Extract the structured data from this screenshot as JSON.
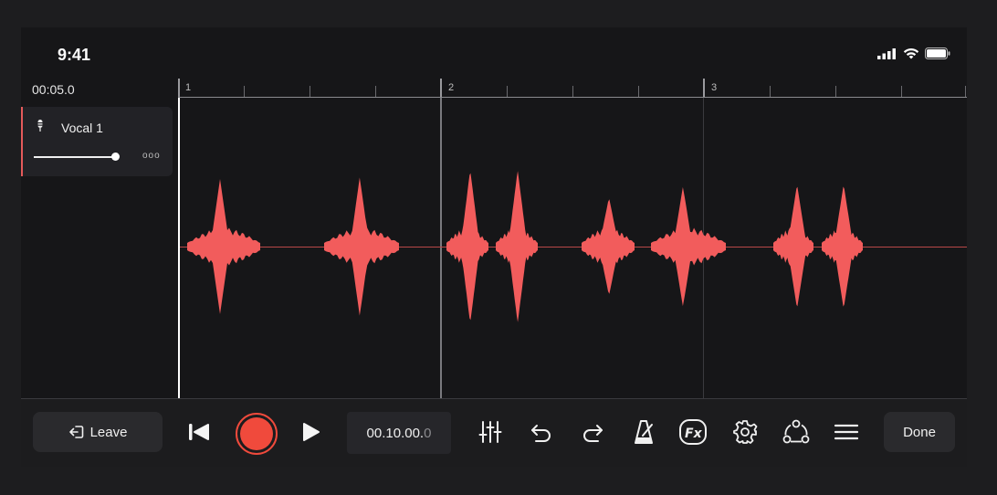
{
  "status_bar": {
    "time": "9:41"
  },
  "position_readout": "00:05.0",
  "ruler": {
    "bars": [
      "1",
      "2",
      "3"
    ]
  },
  "track": {
    "name": "Vocal 1",
    "volume": 0.82,
    "more_label": "ooo"
  },
  "toolbar": {
    "leave_label": "Leave",
    "time_main": "00.10.00.",
    "time_dim": "0",
    "done_label": "Done"
  },
  "colors": {
    "waveform": "#f25c5c",
    "record": "#f04a3c",
    "accent_track": "#e55a5a"
  },
  "icons": [
    "mic-icon",
    "leave-icon",
    "skip-back-icon",
    "record-icon",
    "play-icon",
    "mixer-icon",
    "undo-icon",
    "redo-icon",
    "metronome-icon",
    "fx-icon",
    "settings-icon",
    "share-icon",
    "menu-icon"
  ]
}
